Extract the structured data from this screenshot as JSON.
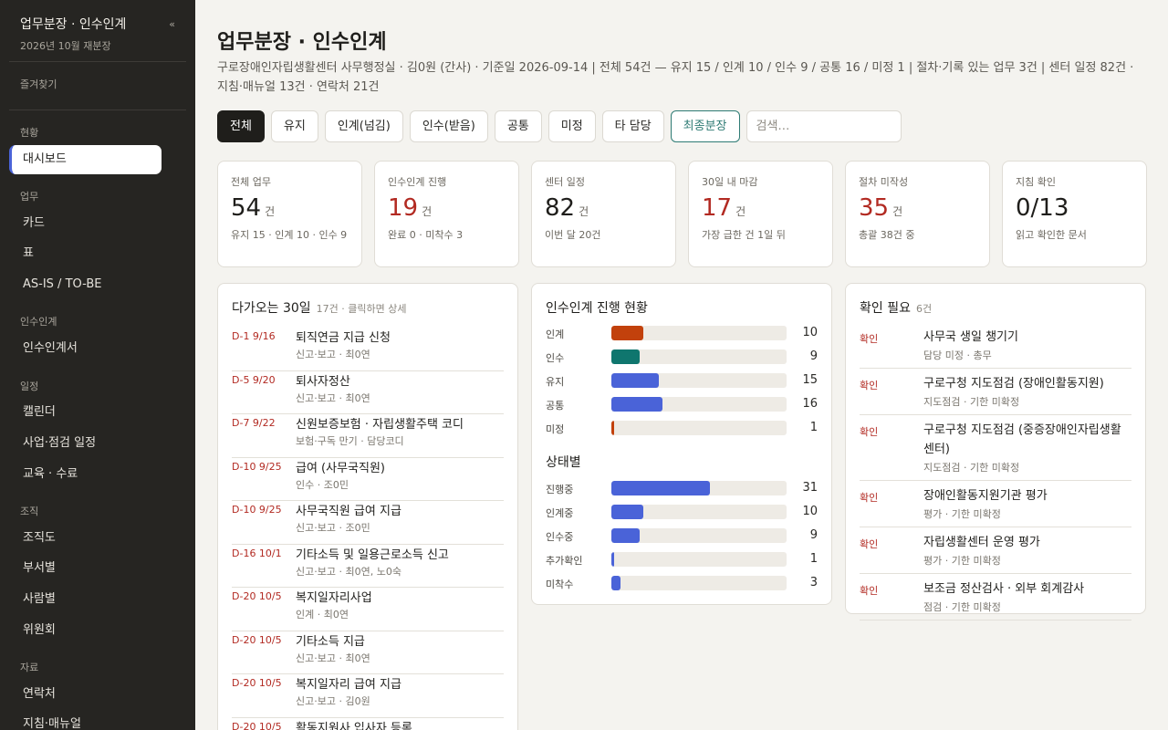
{
  "sidebar": {
    "title": "업무분장 · 인수인계",
    "subtitle": "2026년 10월 재분장",
    "collapse": "«",
    "favorites": "즐겨찾기",
    "sections": {
      "status": "현황",
      "work": "업무",
      "handover": "인수인계",
      "schedule": "일정",
      "org": "조직",
      "resources": "자료"
    },
    "items": {
      "dashboard": "대시보드",
      "card": "카드",
      "table": "표",
      "asis": "AS-IS / TO-BE",
      "handover_doc": "인수인계서",
      "calendar": "캘린더",
      "biz_schedule": "사업·점검 일정",
      "education": "교육 · 수료",
      "org_chart": "조직도",
      "by_dept": "부서별",
      "by_person": "사람별",
      "committee": "위원회",
      "contacts": "연락처",
      "guides": "지침·매뉴얼"
    }
  },
  "header": {
    "title": "업무분장 · 인수인계",
    "subtitle": "구로장애인자립생활센터 사무행정실 · 김0원 (간사) · 기준일 2026-09-14 | 전체 54건 — 유지 15 / 인계 10 / 인수 9 / 공통 16 / 미정 1 | 절차·기록 있는 업무 3건 | 센터 일정 82건 · 지침·매뉴얼 13건 · 연락처 21건"
  },
  "filters": {
    "all": "전체",
    "keep": "유지",
    "handover": "인계(넘김)",
    "takeover": "인수(받음)",
    "common": "공통",
    "undecided": "미정",
    "other": "타 담당",
    "final": "최종분장",
    "search_placeholder": "검색…"
  },
  "stats": [
    {
      "label": "전체 업무",
      "value": "54",
      "unit": "건",
      "note": "유지 15 · 인계 10 · 인수 9"
    },
    {
      "label": "인수인계 진행",
      "value": "19",
      "unit": "건",
      "note": "완료 0 · 미착수 3"
    },
    {
      "label": "센터 일정",
      "value": "82",
      "unit": "건",
      "note": "이번 달 20건"
    },
    {
      "label": "30일 내 마감",
      "value": "17",
      "unit": "건",
      "note": "가장 급한 건 1일 뒤"
    },
    {
      "label": "절차 미작성",
      "value": "35",
      "unit": "건",
      "note": "총괄 38건 중"
    },
    {
      "label": "지침 확인",
      "value": "0/13",
      "unit": "",
      "note": "읽고 확인한 문서"
    }
  ],
  "upcoming": {
    "title": "다가오는 30일",
    "meta": "17건 · 클릭하면 상세",
    "items": [
      {
        "d": "D-1 9/16",
        "title": "퇴직연금 지급 신청",
        "sub": "신고·보고 · 최0연"
      },
      {
        "d": "D-5 9/20",
        "title": "퇴사자정산",
        "sub": "신고·보고 · 최0연"
      },
      {
        "d": "D-7 9/22",
        "title": "신원보증보험 · 자립생활주택 코디",
        "sub": "보험·구독 만기 · 담당코디"
      },
      {
        "d": "D-10 9/25",
        "title": "급여 (사무국직원)",
        "sub": "인수 · 조0민"
      },
      {
        "d": "D-10 9/25",
        "title": "사무국직원 급여 지급",
        "sub": "신고·보고 · 조0민"
      },
      {
        "d": "D-16 10/1",
        "title": "기타소득 및 일용근로소득 신고",
        "sub": "신고·보고 · 최0연, 노0숙"
      },
      {
        "d": "D-20 10/5",
        "title": "복지일자리사업",
        "sub": "인계 · 최0연"
      },
      {
        "d": "D-20 10/5",
        "title": "기타소득 지급",
        "sub": "신고·보고 · 최0연"
      },
      {
        "d": "D-20 10/5",
        "title": "복지일자리 급여 지급",
        "sub": "신고·보고 · 김0원"
      },
      {
        "d": "D-20 10/5",
        "title": "활동지원사 입사자 등록",
        "sub": ""
      }
    ]
  },
  "progress": {
    "title": "인수인계 진행 현황",
    "status_title": "상태별",
    "max": 55,
    "types": [
      {
        "label": "인계",
        "value": 10,
        "color": "#c2410c"
      },
      {
        "label": "인수",
        "value": 9,
        "color": "#0f766e"
      },
      {
        "label": "유지",
        "value": 15,
        "color": "#4a63d8"
      },
      {
        "label": "공통",
        "value": 16,
        "color": "#4a63d8"
      },
      {
        "label": "미정",
        "value": 1,
        "color": "#c2410c"
      }
    ],
    "statuses": [
      {
        "label": "진행중",
        "value": 31,
        "color": "#4a63d8"
      },
      {
        "label": "인계중",
        "value": 10,
        "color": "#4a63d8"
      },
      {
        "label": "인수중",
        "value": 9,
        "color": "#4a63d8"
      },
      {
        "label": "추가확인",
        "value": 1,
        "color": "#4a63d8"
      },
      {
        "label": "미착수",
        "value": 3,
        "color": "#4a63d8"
      }
    ]
  },
  "checks": {
    "title": "확인 필요",
    "count": "6건",
    "tag": "확인",
    "items": [
      {
        "title": "사무국 생일 챙기기",
        "sub": "담당 미정 · 총무"
      },
      {
        "title": "구로구청 지도점검 (장애인활동지원)",
        "sub": "지도점검 · 기한 미확정"
      },
      {
        "title": "구로구청 지도점검 (중증장애인자립생활센터)",
        "sub": "지도점검 · 기한 미확정"
      },
      {
        "title": "장애인활동지원기관 평가",
        "sub": "평가 · 기한 미확정"
      },
      {
        "title": "자립생활센터 운영 평가",
        "sub": "평가 · 기한 미확정"
      },
      {
        "title": "보조금 정산검사 · 외부 회계감사",
        "sub": "점검 · 기한 미확정"
      }
    ]
  }
}
